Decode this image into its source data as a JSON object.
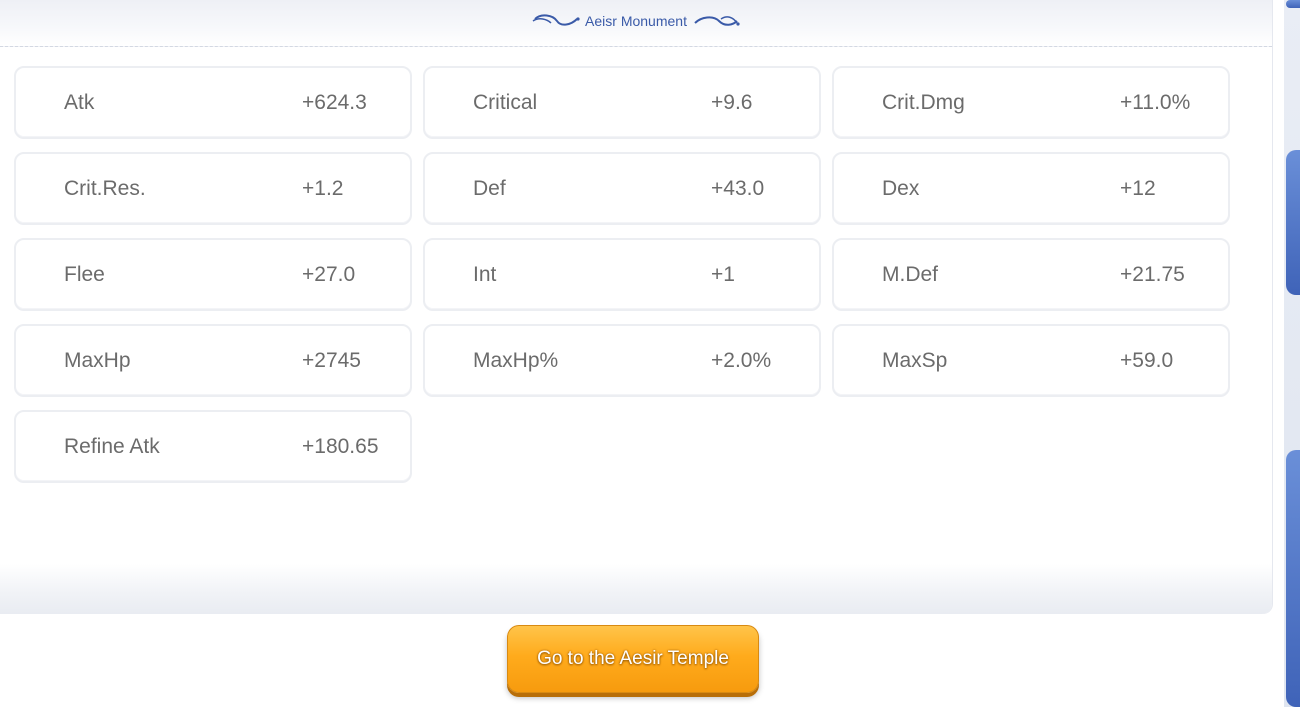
{
  "panel": {
    "title": "Aeisr Monument"
  },
  "stats": [
    {
      "name": "Atk",
      "value": "+624.3"
    },
    {
      "name": "Critical",
      "value": "+9.6"
    },
    {
      "name": "Crit.Dmg",
      "value": "+11.0%"
    },
    {
      "name": "Crit.Res.",
      "value": "+1.2"
    },
    {
      "name": "Def",
      "value": "+43.0"
    },
    {
      "name": "Dex",
      "value": "+12"
    },
    {
      "name": "Flee",
      "value": "+27.0"
    },
    {
      "name": "Int",
      "value": "+1"
    },
    {
      "name": "M.Def",
      "value": "+21.75"
    },
    {
      "name": "MaxHp",
      "value": "+2745"
    },
    {
      "name": "MaxHp%",
      "value": "+2.0%"
    },
    {
      "name": "MaxSp",
      "value": "+59.0"
    },
    {
      "name": "Refine Atk",
      "value": "+180.65"
    }
  ],
  "action": {
    "label": "Go to the Aesir Temple"
  },
  "colors": {
    "title": "#3a5aa8",
    "stat_text": "#6b6b6b",
    "button": "#ffab1c"
  },
  "icons": {
    "title_ornament_left": "swirl-ornament-icon",
    "title_ornament_right": "swirl-ornament-icon"
  }
}
